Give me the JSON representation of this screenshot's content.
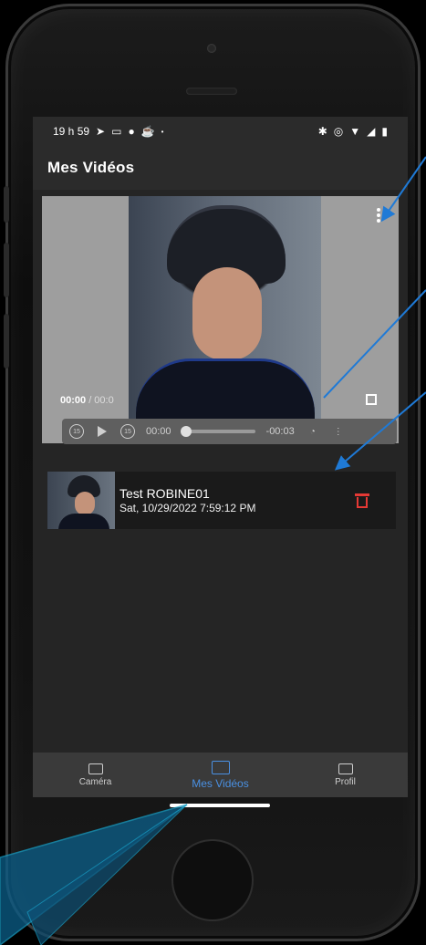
{
  "status_bar": {
    "time": "19 h 59",
    "left_icons": [
      "telegram-icon",
      "chat-icon",
      "location-icon",
      "teacup-icon",
      "dot-icon"
    ],
    "right_icons": [
      "bluetooth-icon",
      "location-icon",
      "wifi-icon",
      "signal-icon",
      "battery-icon"
    ]
  },
  "app_bar": {
    "title": "Mes Vidéos"
  },
  "player": {
    "current_time": "00:00",
    "duration_fragment": " / 00:0",
    "controls": {
      "rewind_label": "15",
      "forward_label": "15",
      "elapsed": "00:00",
      "remaining": "-00:03"
    }
  },
  "video_list": [
    {
      "title": "Test ROBINE01",
      "date": "Sat, 10/29/2022 7:59:12 PM"
    }
  ],
  "bottom_nav": {
    "items": [
      {
        "label": "Caméra",
        "icon": "camera-icon"
      },
      {
        "label": "Mes Vidéos",
        "icon": "videos-icon"
      },
      {
        "label": "Profil",
        "icon": "profile-icon"
      }
    ],
    "active_index": 1
  },
  "colors": {
    "accent": "#4a90e2",
    "delete": "#e53935",
    "annotation": "#1f7ad6",
    "annotation_fill": "#0b5f8a"
  }
}
